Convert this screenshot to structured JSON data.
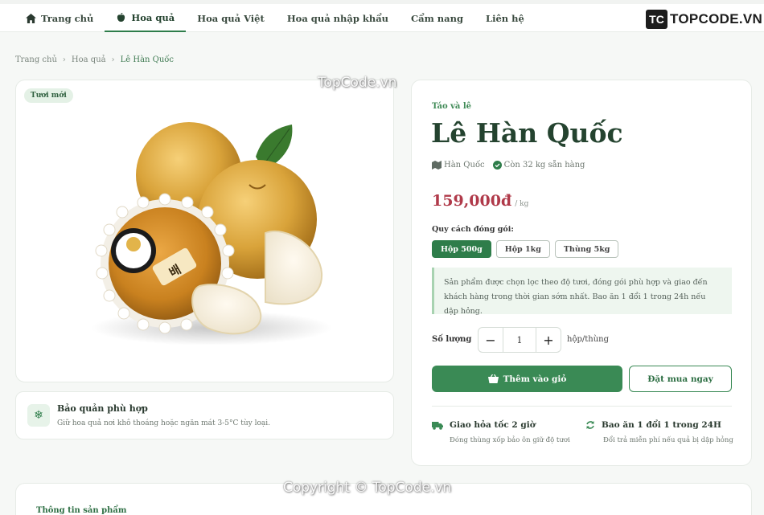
{
  "nav": {
    "items": [
      {
        "label": "Trang chủ",
        "icon": "home-icon"
      },
      {
        "label": "Hoa quả",
        "icon": "apple-icon",
        "active": true
      },
      {
        "label": "Hoa quả Việt"
      },
      {
        "label": "Hoa quả nhập khẩu"
      },
      {
        "label": "Cẩm nang"
      },
      {
        "label": "Liên hệ"
      }
    ],
    "logo_mark": "TC",
    "logo_text_a": "TOPCODE",
    "logo_text_b": ".VN"
  },
  "breadcrumb": {
    "items": [
      "Trang chủ",
      "Hoa quả",
      "Lê Hàn Quốc"
    ]
  },
  "image_card": {
    "badge": "Tươi mới",
    "label_text": "배"
  },
  "storage": {
    "icon": "snowflake-icon",
    "title": "Bảo quản phù hợp",
    "desc": "Giữ hoa quả nơi khô thoáng hoặc ngăn mát 3-5°C tùy loại."
  },
  "product": {
    "category": "Táo và lê",
    "title": "Lê Hàn Quốc",
    "origin": "Hàn Quốc",
    "stock": "Còn 32 kg sẵn hàng",
    "price": "159,000đ",
    "price_unit": "/ kg",
    "pack_label": "Quy cách đóng gói:",
    "pack_options": [
      "Hộp 500g",
      "Hộp 1kg",
      "Thùng 5kg"
    ],
    "pack_selected": "Hộp 500g",
    "notice": "Sản phẩm được chọn lọc theo độ tươi, đóng gói phù hợp và giao đến khách hàng trong thời gian sớm nhất. Bao ăn 1 đổi 1 trong 24h nếu dập hỏng.",
    "qty_label": "Số lượng",
    "qty_value": "1",
    "qty_unit": "hộp/thùng",
    "add_to_cart": "Thêm vào giỏ",
    "buy_now": "Đặt mua ngay"
  },
  "features": [
    {
      "icon": "truck-icon",
      "title": "Giao hỏa tốc 2 giờ",
      "desc": "Đóng thùng xốp bảo ôn giữ độ tươi"
    },
    {
      "icon": "refresh-icon",
      "title": "Bao ăn 1 đổi 1 trong 24H",
      "desc": "Đổi trả miễn phí nếu quả bị dập hỏng"
    }
  ],
  "info": {
    "title": "Thông tin sản phẩm"
  },
  "watermarks": {
    "top": "TopCode.vn",
    "bottom": "Copyright © TopCode.vn"
  },
  "colors": {
    "primary": "#2e7d4a",
    "price": "#b03a4a",
    "logo_red": "#c62828"
  }
}
